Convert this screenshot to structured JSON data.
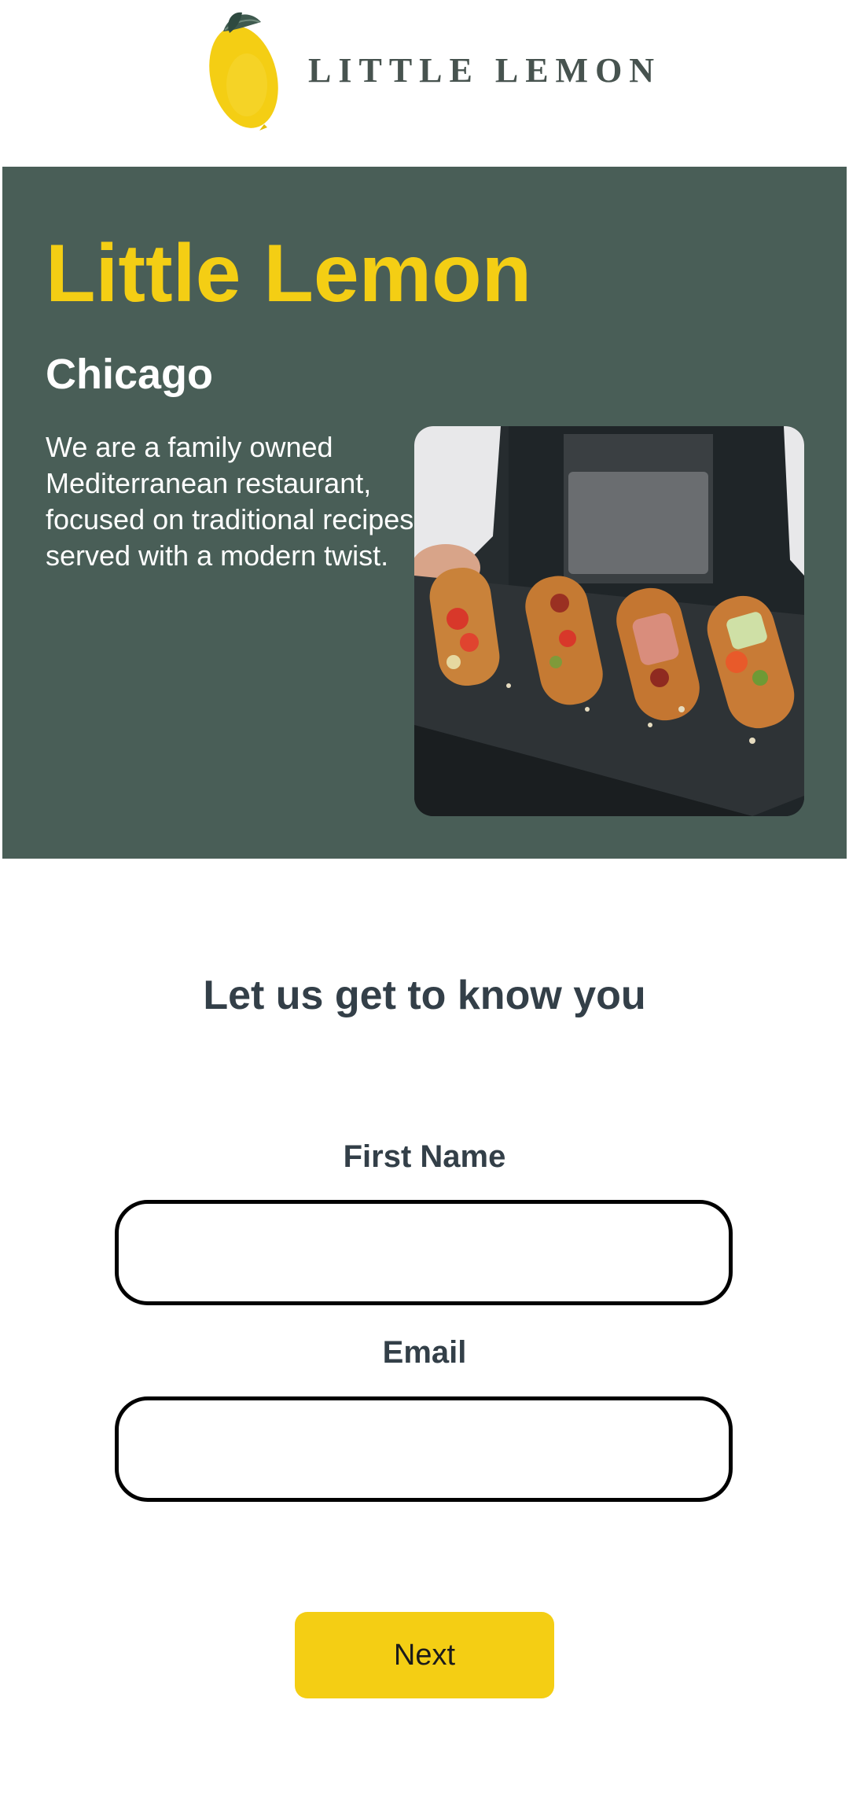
{
  "header": {
    "logo_text": "LITTLE LEMON",
    "logo_icon": "lemon-icon"
  },
  "hero": {
    "title": "Little Lemon",
    "city": "Chicago",
    "description": "We are a family owned Mediterranean restaurant, focused on traditional recipes served with a modern twist.",
    "image": "food-platter-image"
  },
  "form": {
    "heading": "Let us get to know you",
    "first_name_label": "First Name",
    "first_name_value": "",
    "email_label": "Email",
    "email_value": "",
    "next_label": "Next"
  },
  "colors": {
    "primary_green": "#495e57",
    "primary_yellow": "#f4ce14",
    "text_dark": "#333f48"
  }
}
